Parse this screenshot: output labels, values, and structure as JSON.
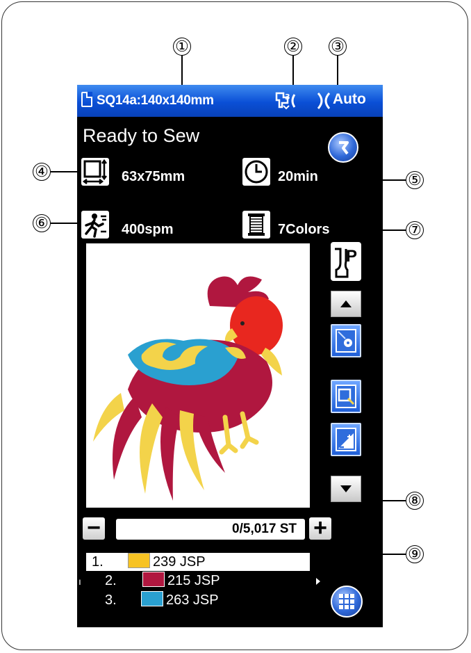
{
  "header": {
    "hoop_label": "SQ14a:140x140mm",
    "auto_label": "Auto"
  },
  "status": "Ready to Sew",
  "info": {
    "design_size": "63x75mm",
    "sewing_time": "20min",
    "speed": "400spm",
    "colors": "7Colors"
  },
  "stitch_counter": "0/5,017 ST",
  "color_list": [
    {
      "index": "1.",
      "color": "#f7c324",
      "code": "239 JSP"
    },
    {
      "index": "2.",
      "color": "#b0173f",
      "code": "215 JSP"
    },
    {
      "index": "3.",
      "color": "#2aa0d0",
      "code": "263 JSP"
    }
  ],
  "callouts": [
    "①",
    "②",
    "③",
    "④",
    "⑤",
    "⑥",
    "⑦",
    "⑧",
    "⑨"
  ],
  "icons": {
    "back": "return-arrow-icon",
    "presser_foot": "presser-foot-p-icon",
    "up": "arrow-up-icon",
    "down": "arrow-down-icon",
    "grid": "grid-icon"
  }
}
